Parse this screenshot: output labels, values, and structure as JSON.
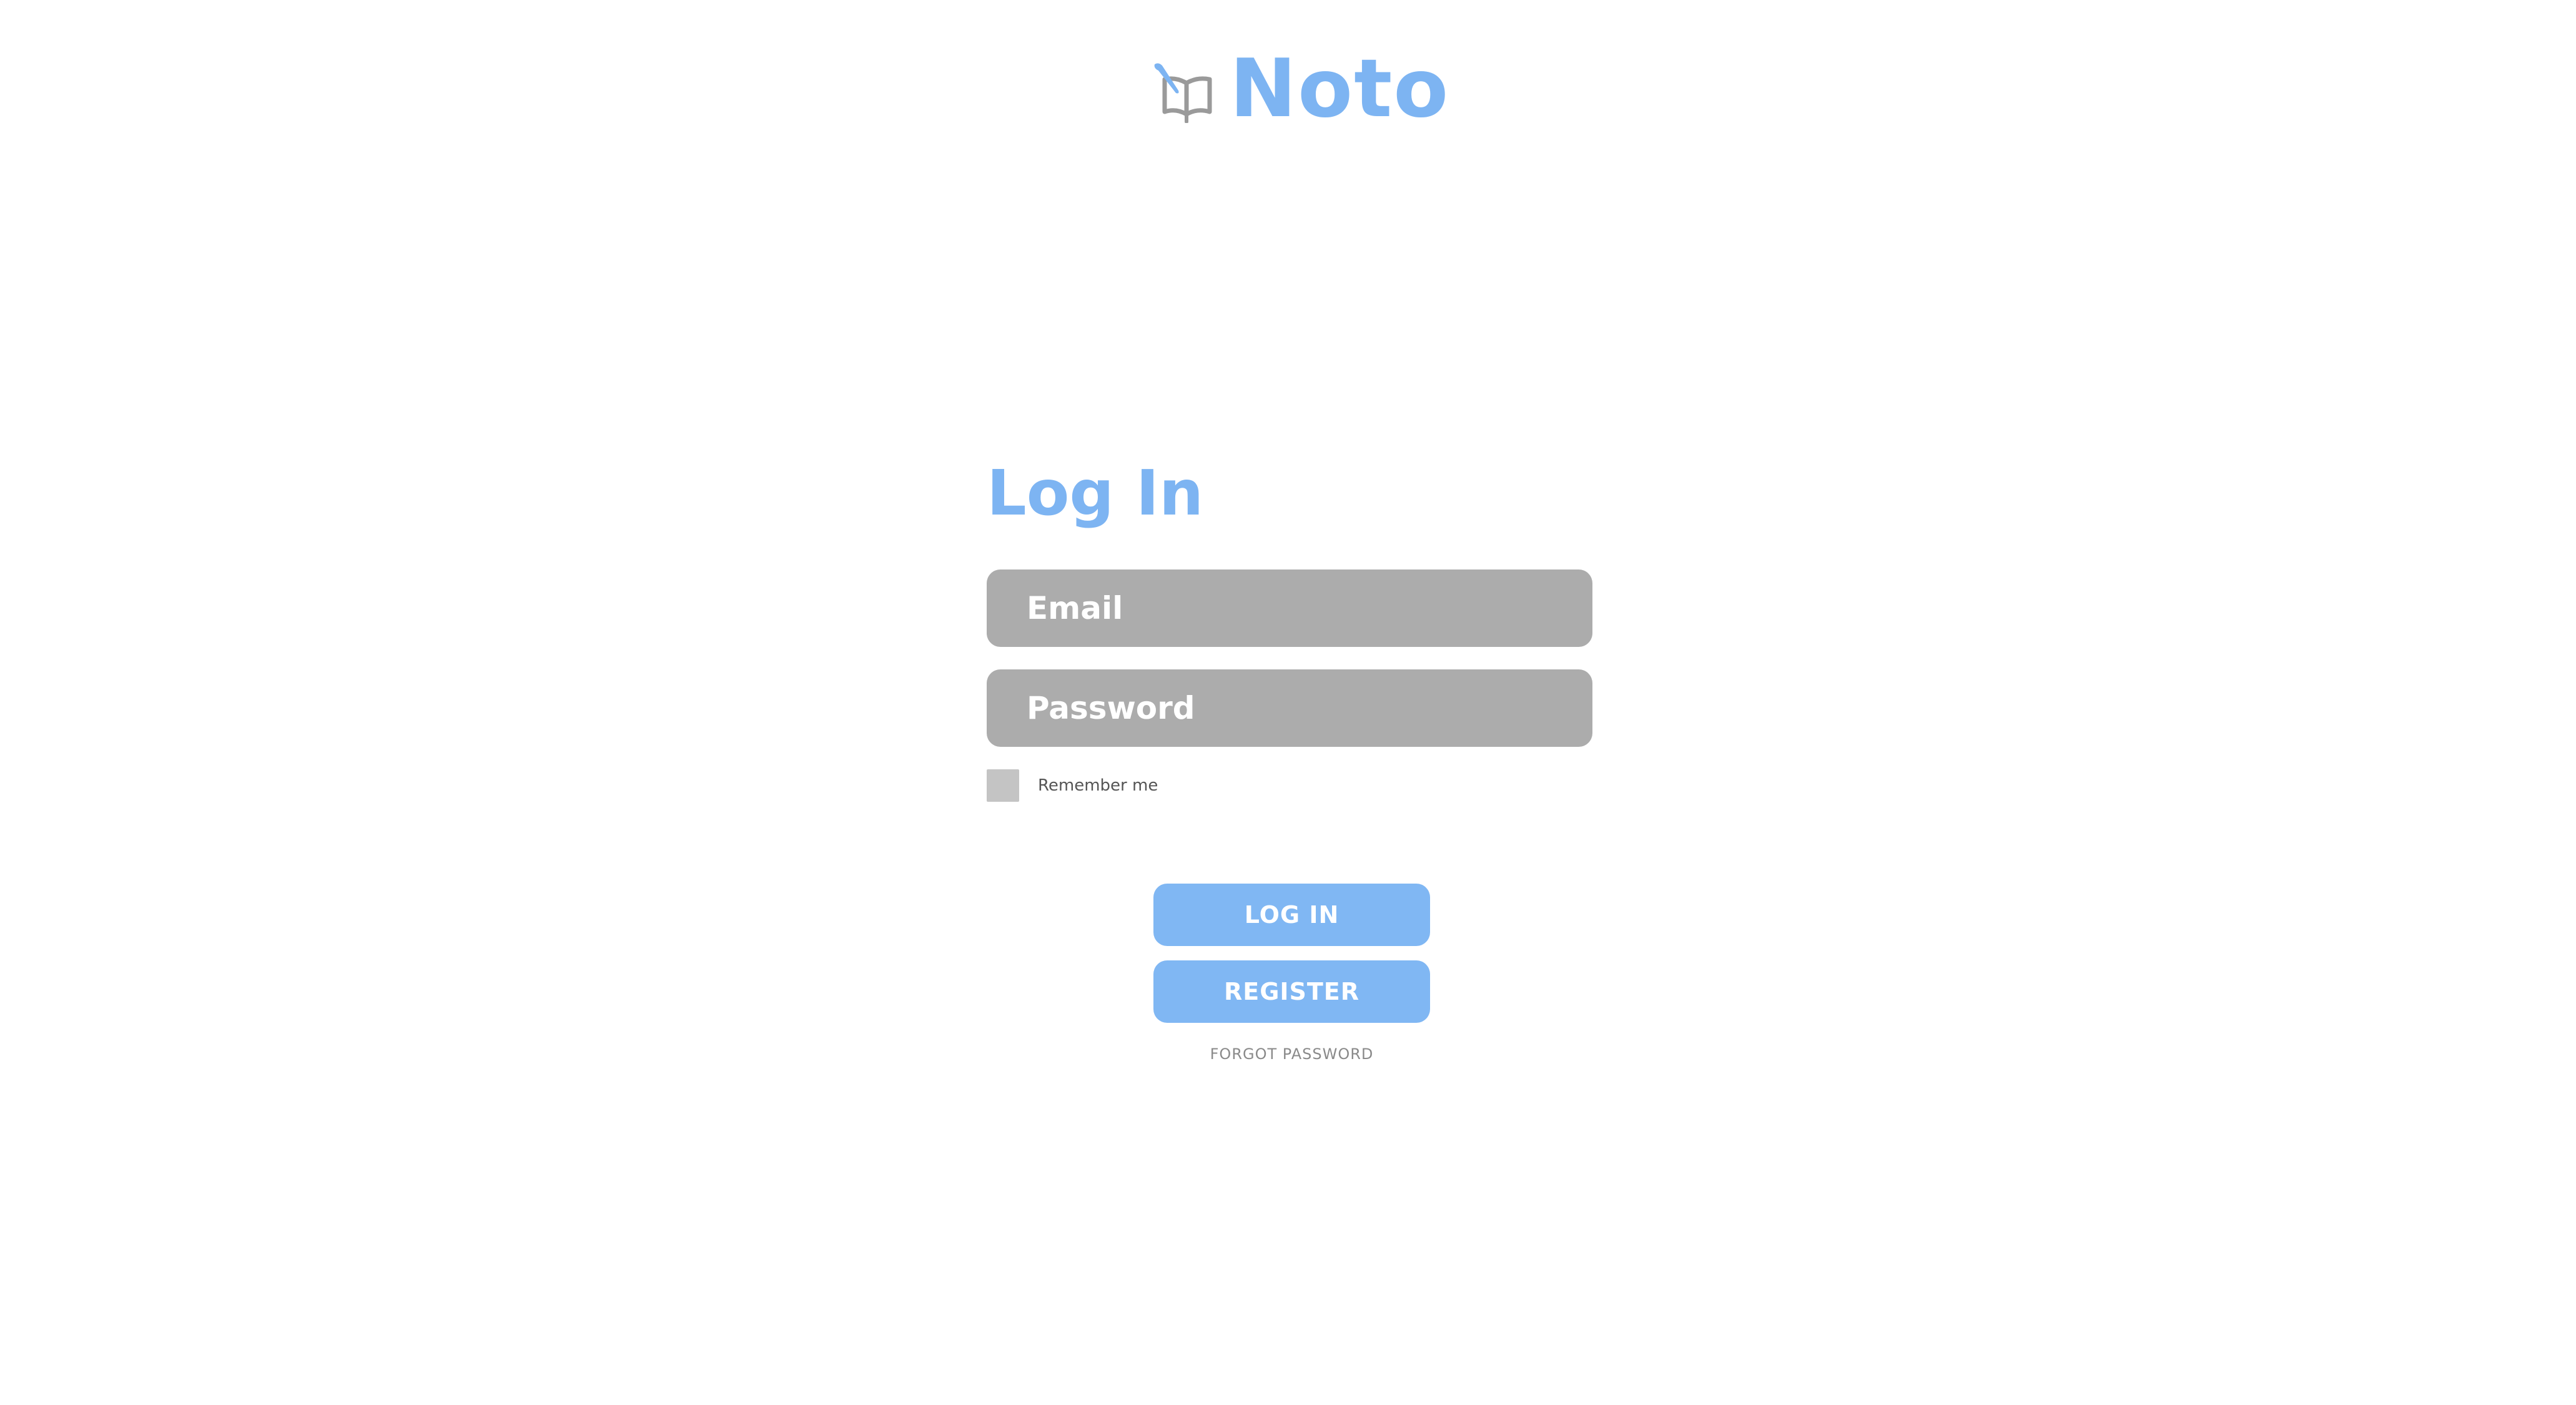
{
  "brand": {
    "name": "Noto",
    "icon": "book-quill-icon",
    "accent_color": "#7db4f2",
    "icon_color": "#9a9a9a"
  },
  "login_form": {
    "title": "Log In",
    "email_placeholder": "Email",
    "password_placeholder": "Password",
    "remember_label": "Remember me",
    "remember_checked": false
  },
  "actions": {
    "login_label": "LOG IN",
    "register_label": "REGISTER",
    "forgot_label": "FORGOT PASSWORD",
    "button_color": "#80b7f3"
  },
  "colors": {
    "field_background": "#acacac",
    "checkbox_background": "#c4c4c4"
  }
}
